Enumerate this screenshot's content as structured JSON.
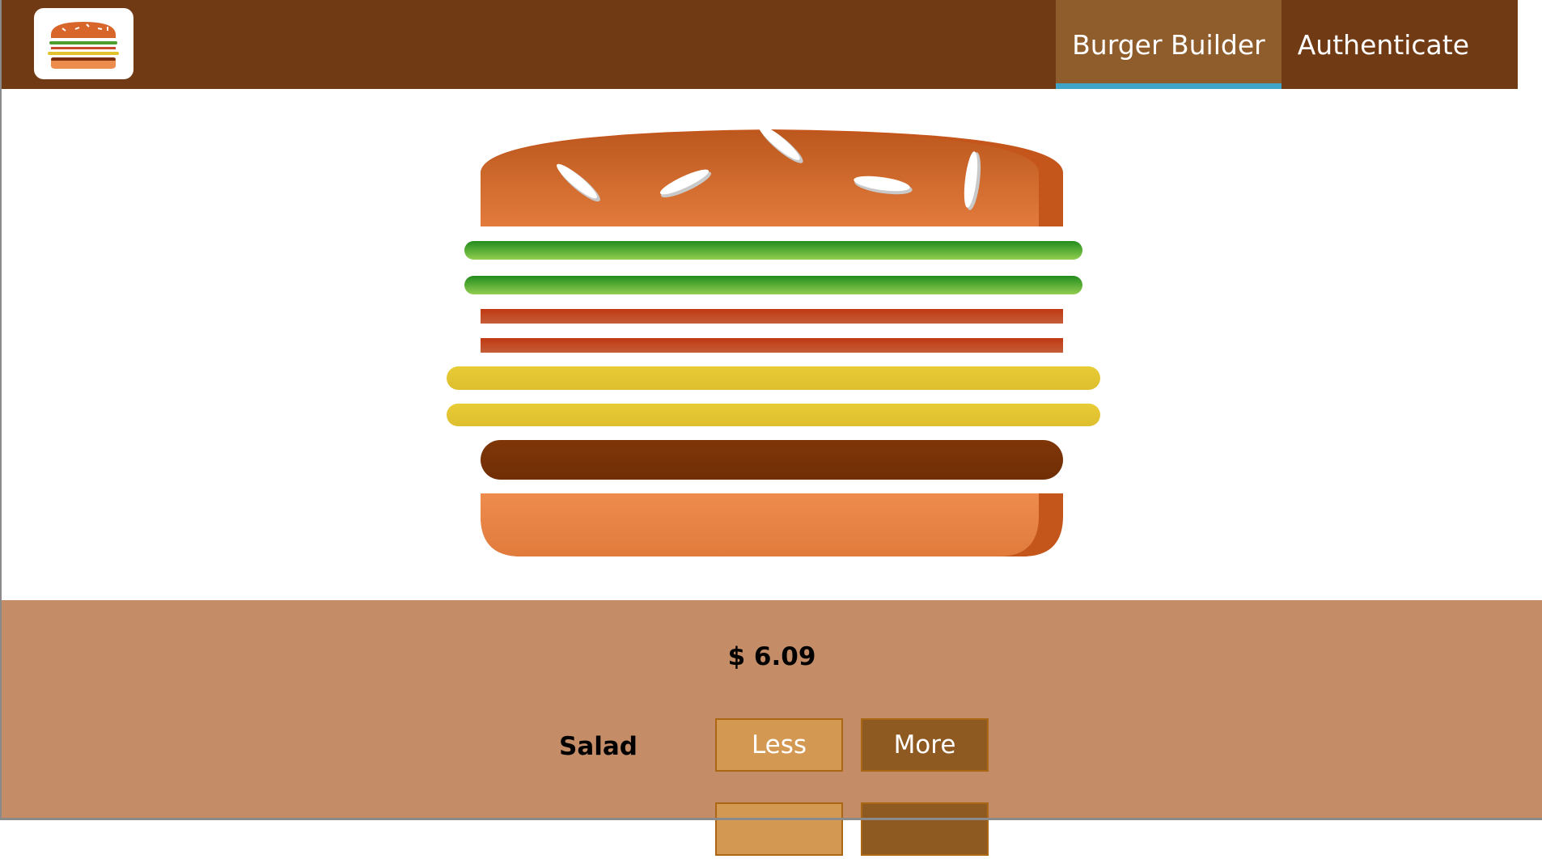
{
  "toolbar": {
    "nav": [
      {
        "label": "Burger Builder",
        "active": true
      },
      {
        "label": "Authenticate",
        "active": false
      }
    ]
  },
  "burger": {
    "ingredients_top_to_bottom": [
      "bread-top",
      "salad",
      "salad",
      "bacon",
      "bacon",
      "cheese",
      "cheese",
      "meat",
      "bread-bottom"
    ]
  },
  "build_controls": {
    "price": "$ 6.09",
    "rows": [
      {
        "label": "Salad",
        "less": "Less",
        "more": "More"
      }
    ]
  },
  "colors": {
    "toolbar": "#703B14",
    "nav_active": "#8F5C2C",
    "nav_active_underline": "#40A4C8",
    "controls_bg": "#C48D68",
    "less_button": "#D39952",
    "more_button": "#8F5A22"
  }
}
